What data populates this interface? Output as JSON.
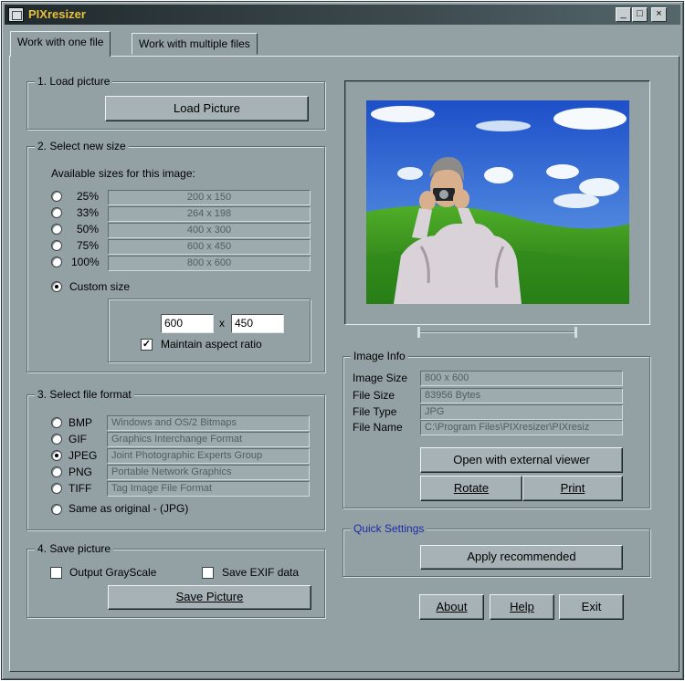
{
  "window": {
    "title": "PIXresizer",
    "minimize": "_",
    "maximize": "□",
    "close": "×"
  },
  "tabs": [
    {
      "label": "Work with one file",
      "active": true
    },
    {
      "label": "Work with multiple files",
      "active": false
    }
  ],
  "load": {
    "legend": "1. Load picture",
    "button": "Load Picture"
  },
  "size": {
    "legend": "2. Select new size",
    "caption": "Available sizes for this image:",
    "options": [
      {
        "pct": "25%",
        "dims": "200 x 150"
      },
      {
        "pct": "33%",
        "dims": "264 x 198"
      },
      {
        "pct": "50%",
        "dims": "400 x 300"
      },
      {
        "pct": "75%",
        "dims": "600 x 450"
      },
      {
        "pct": "100%",
        "dims": "800 x 600"
      }
    ],
    "custom_label": "Custom size",
    "custom_selected": true,
    "width": "600",
    "x": "x",
    "height": "450",
    "aspect_label": "Maintain aspect ratio",
    "aspect_checked": true
  },
  "format": {
    "legend": "3. Select file format",
    "options": [
      {
        "name": "BMP",
        "desc": "Windows and OS/2 Bitmaps",
        "selected": false
      },
      {
        "name": "GIF",
        "desc": "Graphics Interchange Format",
        "selected": false
      },
      {
        "name": "JPEG",
        "desc": "Joint Photographic Experts Group",
        "selected": true
      },
      {
        "name": "PNG",
        "desc": "Portable Network Graphics",
        "selected": false
      },
      {
        "name": "TIFF",
        "desc": "Tag Image File Format",
        "selected": false
      }
    ],
    "same_label": "Same as original  - (JPG)"
  },
  "save": {
    "legend": "4. Save picture",
    "grayscale_label": "Output GrayScale",
    "exif_label": "Save EXIF data",
    "button": "Save Picture"
  },
  "info": {
    "legend": "Image Info",
    "rows": [
      {
        "label": "Image Size",
        "value": "800 x 600"
      },
      {
        "label": "File Size",
        "value": "83956 Bytes"
      },
      {
        "label": "File Type",
        "value": "JPG"
      },
      {
        "label": "File Name",
        "value": "C:\\Program Files\\PIXresizer\\PIXresiz"
      }
    ],
    "open_button": "Open with external viewer",
    "rotate_button": "Rotate",
    "print_button": "Print"
  },
  "quick": {
    "legend": "Quick Settings",
    "legend_color": "#1d2aa8",
    "button": "Apply recommended"
  },
  "footer": {
    "about": "About",
    "help": "Help",
    "exit": "Exit"
  },
  "colors": {
    "window_bg": "#93a1a5",
    "title_text": "#e8c13b"
  }
}
